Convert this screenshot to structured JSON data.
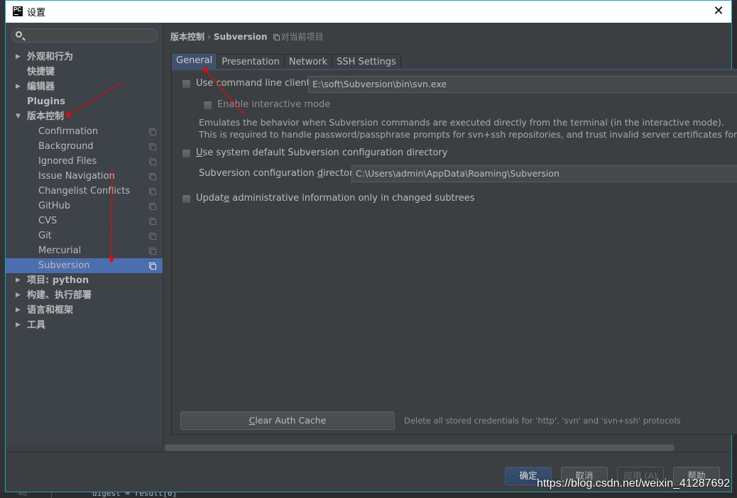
{
  "window": {
    "title": "设置",
    "logo_text": "PC"
  },
  "sidebar": {
    "search": {
      "value": "",
      "placeholder": ""
    },
    "items": [
      {
        "label": "外观和行为",
        "level": 0,
        "expandable": true,
        "expanded": false
      },
      {
        "label": "快捷键",
        "level": 0,
        "expandable": false
      },
      {
        "label": "编辑器",
        "level": 0,
        "expandable": true,
        "expanded": false
      },
      {
        "label": "Plugins",
        "level": 0,
        "expandable": false
      },
      {
        "label": "版本控制",
        "level": 0,
        "expandable": true,
        "expanded": true
      },
      {
        "label": "Confirmation",
        "level": 1,
        "project_icon": true
      },
      {
        "label": "Background",
        "level": 1,
        "project_icon": true
      },
      {
        "label": "Ignored Files",
        "level": 1,
        "project_icon": true
      },
      {
        "label": "Issue Navigation",
        "level": 1,
        "project_icon": true
      },
      {
        "label": "Changelist Conflicts",
        "level": 1,
        "project_icon": true
      },
      {
        "label": "GitHub",
        "level": 1,
        "project_icon": true
      },
      {
        "label": "CVS",
        "level": 1,
        "project_icon": true
      },
      {
        "label": "Git",
        "level": 1,
        "project_icon": true
      },
      {
        "label": "Mercurial",
        "level": 1,
        "project_icon": true
      },
      {
        "label": "Subversion",
        "level": 1,
        "project_icon": true,
        "selected": true
      },
      {
        "label": "项目: python",
        "level": 0,
        "expandable": true,
        "expanded": false
      },
      {
        "label": "构建、执行部署",
        "level": 0,
        "expandable": true,
        "expanded": false
      },
      {
        "label": "语言和框架",
        "level": 0,
        "expandable": true,
        "expanded": false
      },
      {
        "label": "工具",
        "level": 0,
        "expandable": true,
        "expanded": false
      }
    ]
  },
  "breadcrumb": {
    "root": "版本控制",
    "separator": "›",
    "leaf": "Subversion",
    "scope": "对当前项目"
  },
  "tabs": [
    {
      "label": "General",
      "active": true
    },
    {
      "label": "Presentation",
      "active": false
    },
    {
      "label": "Network",
      "active": false
    },
    {
      "label": "SSH Settings",
      "active": false
    }
  ],
  "general": {
    "use_cmd_client": {
      "label": "Use command line client:",
      "checked": false,
      "value": "E:\\soft\\Subversion\\bin\\svn.exe"
    },
    "interactive_mode": {
      "label": "Enable interactive mode",
      "checked": false
    },
    "interactive_desc_1": "Emulates the behavior when Subversion commands are executed directly from the terminal (in the interactive mode).",
    "interactive_desc_2": "This is required to handle password/passphrase prompts for svn+ssh repositories, and trust invalid server certificates for https r",
    "use_system_default": {
      "label_u": "U",
      "label_rest": "se system default Subversion configuration directory",
      "checked": false
    },
    "config_dir": {
      "label_pre": "Subversion configuration ",
      "label_u": "d",
      "label_post": "irectory:",
      "value": "C:\\Users\\admin\\AppData\\Roaming\\Subversion"
    },
    "update_admin": {
      "label_pre": "Updat",
      "label_u": "e",
      "label_post": " administrative information only in changed subtrees",
      "checked": false
    },
    "clear_cache": {
      "label_u": "C",
      "label_rest": "lear Auth Cache"
    },
    "clear_cache_desc": "Delete all stored credentials for 'http', 'svn' and 'svn+ssh' protocols"
  },
  "footer": {
    "ok": "确定",
    "cancel": "取消",
    "apply": "应用 (A)",
    "help": "帮助"
  },
  "background_editor": {
    "line_number": "40",
    "code": "digest = result[0]"
  },
  "watermark": "https://blog.csdn.net/weixin_41287692",
  "colors": {
    "accent": "#4b6eaf",
    "active_tab": "#40516e",
    "dialog_border": "#18a3c0",
    "annotation_arrow": "#ff0000"
  }
}
